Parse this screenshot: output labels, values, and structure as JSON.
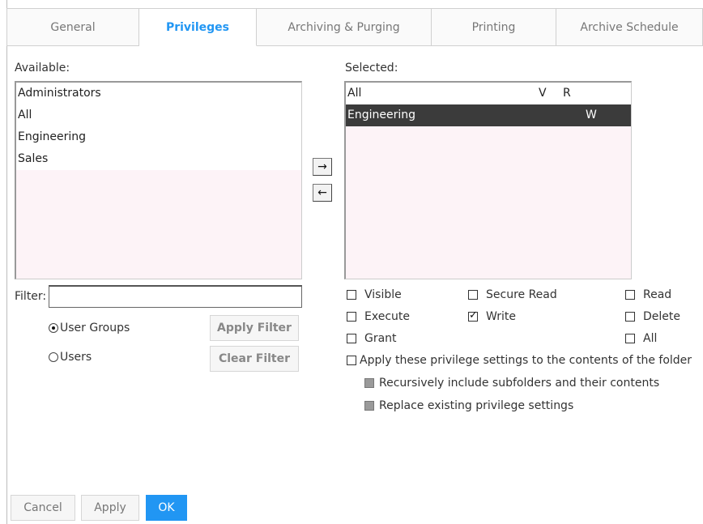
{
  "tabs": [
    {
      "label": "General",
      "active": false
    },
    {
      "label": "Privileges",
      "active": true
    },
    {
      "label": "Archiving & Purging",
      "active": false
    },
    {
      "label": "Printing",
      "active": false
    },
    {
      "label": "Archive Schedule",
      "active": false
    }
  ],
  "available": {
    "label": "Available:",
    "items": [
      "Administrators",
      "All",
      "Engineering",
      "Sales"
    ]
  },
  "selected": {
    "label": "Selected:",
    "items": [
      {
        "name": "All",
        "v": "V",
        "r": "R",
        "w": "",
        "selected": false
      },
      {
        "name": "Engineering",
        "v": "",
        "r": "",
        "w": "W",
        "selected": true
      }
    ]
  },
  "move": {
    "add": "→",
    "remove": "←"
  },
  "filter": {
    "label": "Filter:",
    "value": "",
    "radio_groups": "User Groups",
    "radio_users": "Users",
    "apply": "Apply Filter",
    "clear": "Clear Filter",
    "selected_radio": "User Groups"
  },
  "privileges": {
    "visible": {
      "label": "Visible",
      "checked": false
    },
    "secure_read": {
      "label": "Secure Read",
      "checked": false
    },
    "read": {
      "label": "Read",
      "checked": false
    },
    "execute": {
      "label": "Execute",
      "checked": false
    },
    "write": {
      "label": "Write",
      "checked": true
    },
    "delete": {
      "label": "Delete",
      "checked": false
    },
    "grant": {
      "label": "Grant",
      "checked": false
    },
    "all": {
      "label": "All",
      "checked": false
    }
  },
  "apply_contents": {
    "label": "Apply these privilege settings to the contents of the folder",
    "checked": false
  },
  "recursive": {
    "label": "Recursively include subfolders and their contents"
  },
  "replace": {
    "label": "Replace existing privilege settings"
  },
  "footer": {
    "cancel": "Cancel",
    "apply": "Apply",
    "ok": "OK"
  }
}
